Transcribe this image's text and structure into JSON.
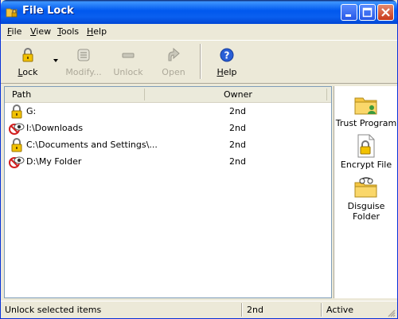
{
  "window": {
    "title": "File Lock"
  },
  "menu": [
    {
      "label": "File",
      "accel": "F",
      "rest": "ile"
    },
    {
      "label": "View",
      "accel": "V",
      "rest": "iew"
    },
    {
      "label": "Tools",
      "accel": "T",
      "rest": "ools"
    },
    {
      "label": "Help",
      "accel": "H",
      "rest": "elp"
    }
  ],
  "toolbar": {
    "lock": "Lock",
    "modify": "Modify...",
    "unlock": "Unlock",
    "open": "Open",
    "help": "Help"
  },
  "list": {
    "columns": {
      "path": "Path",
      "owner": "Owner"
    },
    "rows": [
      {
        "icon": "lock-icon",
        "path": "G:",
        "owner": "2nd"
      },
      {
        "icon": "hidden-eye-icon",
        "path": "I:\\Downloads",
        "owner": "2nd"
      },
      {
        "icon": "lock-icon",
        "path": "C:\\Documents and Settings\\...",
        "owner": "2nd"
      },
      {
        "icon": "hidden-eye-icon",
        "path": "D:\\My Folder",
        "owner": "2nd"
      }
    ]
  },
  "sidepanel": {
    "trust": "Trust Program",
    "encrypt": "Encrypt File",
    "disguise": "Disguise Folder"
  },
  "status": {
    "message": "Unlock selected items",
    "user": "2nd",
    "state": "Active"
  },
  "colors": {
    "titlebar": "#0058EE",
    "face": "#ECE9D8",
    "lock": "#E8B400"
  }
}
